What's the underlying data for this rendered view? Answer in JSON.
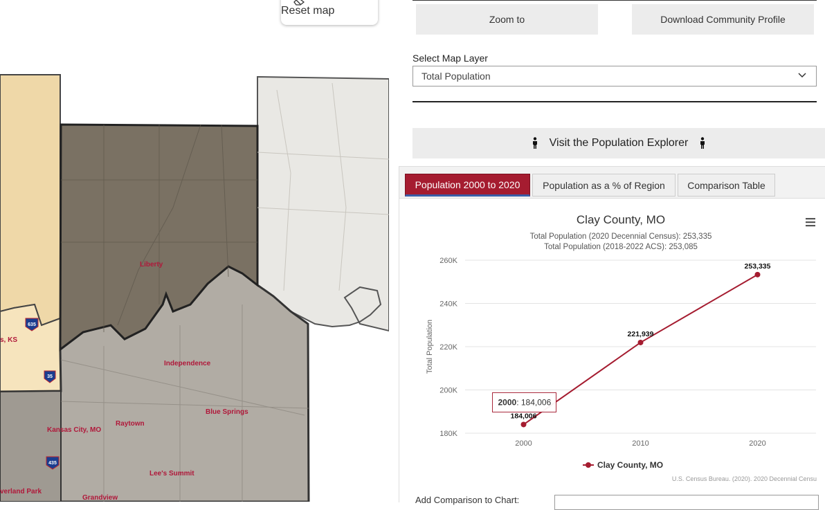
{
  "map": {
    "reset_label": "Reset map",
    "places": [
      "Liberty",
      "Independence",
      "Blue Springs",
      "Raytown",
      "Kansas City, MO",
      "Lee's Summit",
      "Grandview",
      "verland Park",
      "s, KS"
    ],
    "shields": [
      "635",
      "35",
      "435"
    ]
  },
  "panel": {
    "zoom_label": "Zoom to",
    "download_label": "Download Community Profile",
    "layer_label": "Select Map Layer",
    "layer_value": "Total Population",
    "explorer_label": "Visit the Population Explorer",
    "tabs": [
      "Population 2000 to 2020",
      "Population as a % of Region",
      "Comparison Table"
    ],
    "comparison_label": "Add Comparison to Chart:"
  },
  "chart_data": {
    "type": "line",
    "title": "Clay County, MO",
    "subtitle_1": "Total Population (2020 Decennial Census): 253,335",
    "subtitle_2": "Total Population (2018-2022 ACS): 253,085",
    "ylabel": "Total Population",
    "x": [
      2000,
      2010,
      2020
    ],
    "x_labels": [
      "2000",
      "2010",
      "2020"
    ],
    "y_ticks": [
      "180K",
      "200K",
      "220K",
      "240K",
      "260K"
    ],
    "ylim": [
      180000,
      260000
    ],
    "series": [
      {
        "name": "Clay County, MO",
        "values": [
          184006,
          221939,
          253335
        ],
        "color": "#a51c30"
      }
    ],
    "data_labels": [
      "184,006",
      "221,939",
      "253,335"
    ],
    "tooltip": {
      "x": "2000",
      "value": "184,006"
    },
    "credit": "U.S. Census Bureau. (2020). 2020 Decennial Censu"
  }
}
